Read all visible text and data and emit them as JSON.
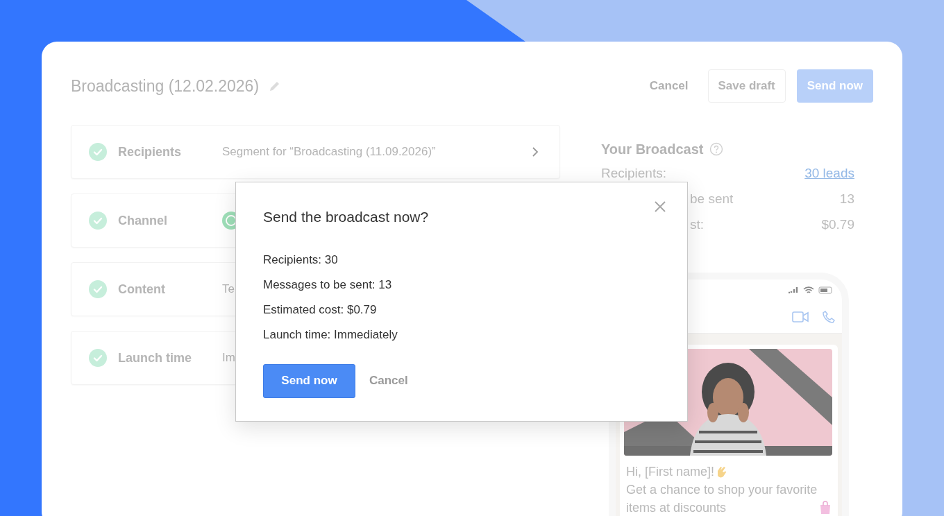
{
  "header": {
    "title": "Broadcasting (12.02.2026)",
    "actions": [
      {
        "label": "Cancel",
        "kind": "link"
      },
      {
        "label": "Save draft",
        "kind": "outline"
      },
      {
        "label": "Send now",
        "kind": "primary"
      }
    ]
  },
  "steps": [
    {
      "label": "Recipients",
      "done": true,
      "kind": "link",
      "value": "Segment for “Broadcasting (11.09.2026)”"
    },
    {
      "label": "Channel",
      "done": true,
      "kind": "channel"
    },
    {
      "label": "Content",
      "done": true,
      "kind": "text",
      "value": "Te"
    },
    {
      "label": "Launch time",
      "done": true,
      "kind": "text",
      "value": "Im"
    }
  ],
  "summary": {
    "title": "Your Broadcast",
    "rows": [
      {
        "label": "Recipients:",
        "value": "30 leads",
        "kind": "link"
      },
      {
        "label": "be sent",
        "value": "13",
        "kind": "partial"
      },
      {
        "label": "st:",
        "value": "$0.79",
        "kind": "partial"
      }
    ]
  },
  "preview": {
    "greeting": "Hi, [First name]!",
    "body": "Get a chance to shop your favorite items at discounts"
  },
  "dialog": {
    "title": "Send the broadcast now?",
    "lines": [
      "Recipients: 30",
      "Messages to be sent: 13",
      "Estimated cost: $0.79",
      "Launch time: Immediately"
    ],
    "confirm": "Send now",
    "cancel": "Cancel"
  }
}
